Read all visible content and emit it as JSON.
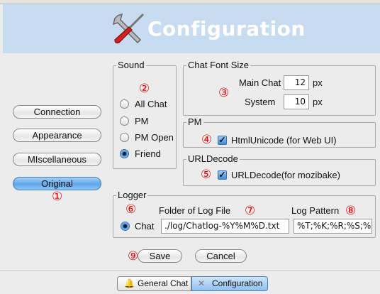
{
  "header": {
    "title": "Configuration",
    "icon": "wrench-screwdriver-icon"
  },
  "sidebar": {
    "items": [
      {
        "label": "Connection"
      },
      {
        "label": "Appearance"
      },
      {
        "label": "MIscellaneous"
      },
      {
        "label": "Original",
        "selected": true
      }
    ]
  },
  "marks": [
    "①",
    "②",
    "③",
    "④",
    "⑤",
    "⑥",
    "⑦",
    "⑧",
    "⑨"
  ],
  "sound": {
    "title": "Sound",
    "options": [
      {
        "label": "All Chat"
      },
      {
        "label": "PM"
      },
      {
        "label": "PM Open"
      },
      {
        "label": "Friend",
        "selected": true
      }
    ]
  },
  "font_size": {
    "title": "Chat Font Size",
    "main_label": "Main Chat",
    "main_value": "12",
    "system_label": "System",
    "system_value": "10",
    "unit": "px"
  },
  "pm": {
    "title": "PM",
    "checkbox_label": "HtmlUnicode (for Web UI)",
    "checked": true
  },
  "urldecode": {
    "title": "URLDecode",
    "checkbox_label": "URLDecode(for mozibake)",
    "checked": true
  },
  "logger": {
    "title": "Logger",
    "radio_label": "Chat",
    "folder_label": "Folder of Log File",
    "folder_value": "./log/Chatlog-%Y%M%D.txt",
    "pattern_label": "Log Pattern",
    "pattern_value": "%T;%K;%R;%S;%M"
  },
  "actions": {
    "save": "Save",
    "cancel": "Cancel"
  },
  "tabs": [
    {
      "label": "General Chat",
      "icon": "bell-icon"
    },
    {
      "label": "Configuration",
      "icon": "wrench-screwdriver-icon",
      "active": true
    }
  ],
  "colors": {
    "header": "#c7dcf0",
    "accent": "#3a8de0",
    "marker": "#e00000"
  }
}
